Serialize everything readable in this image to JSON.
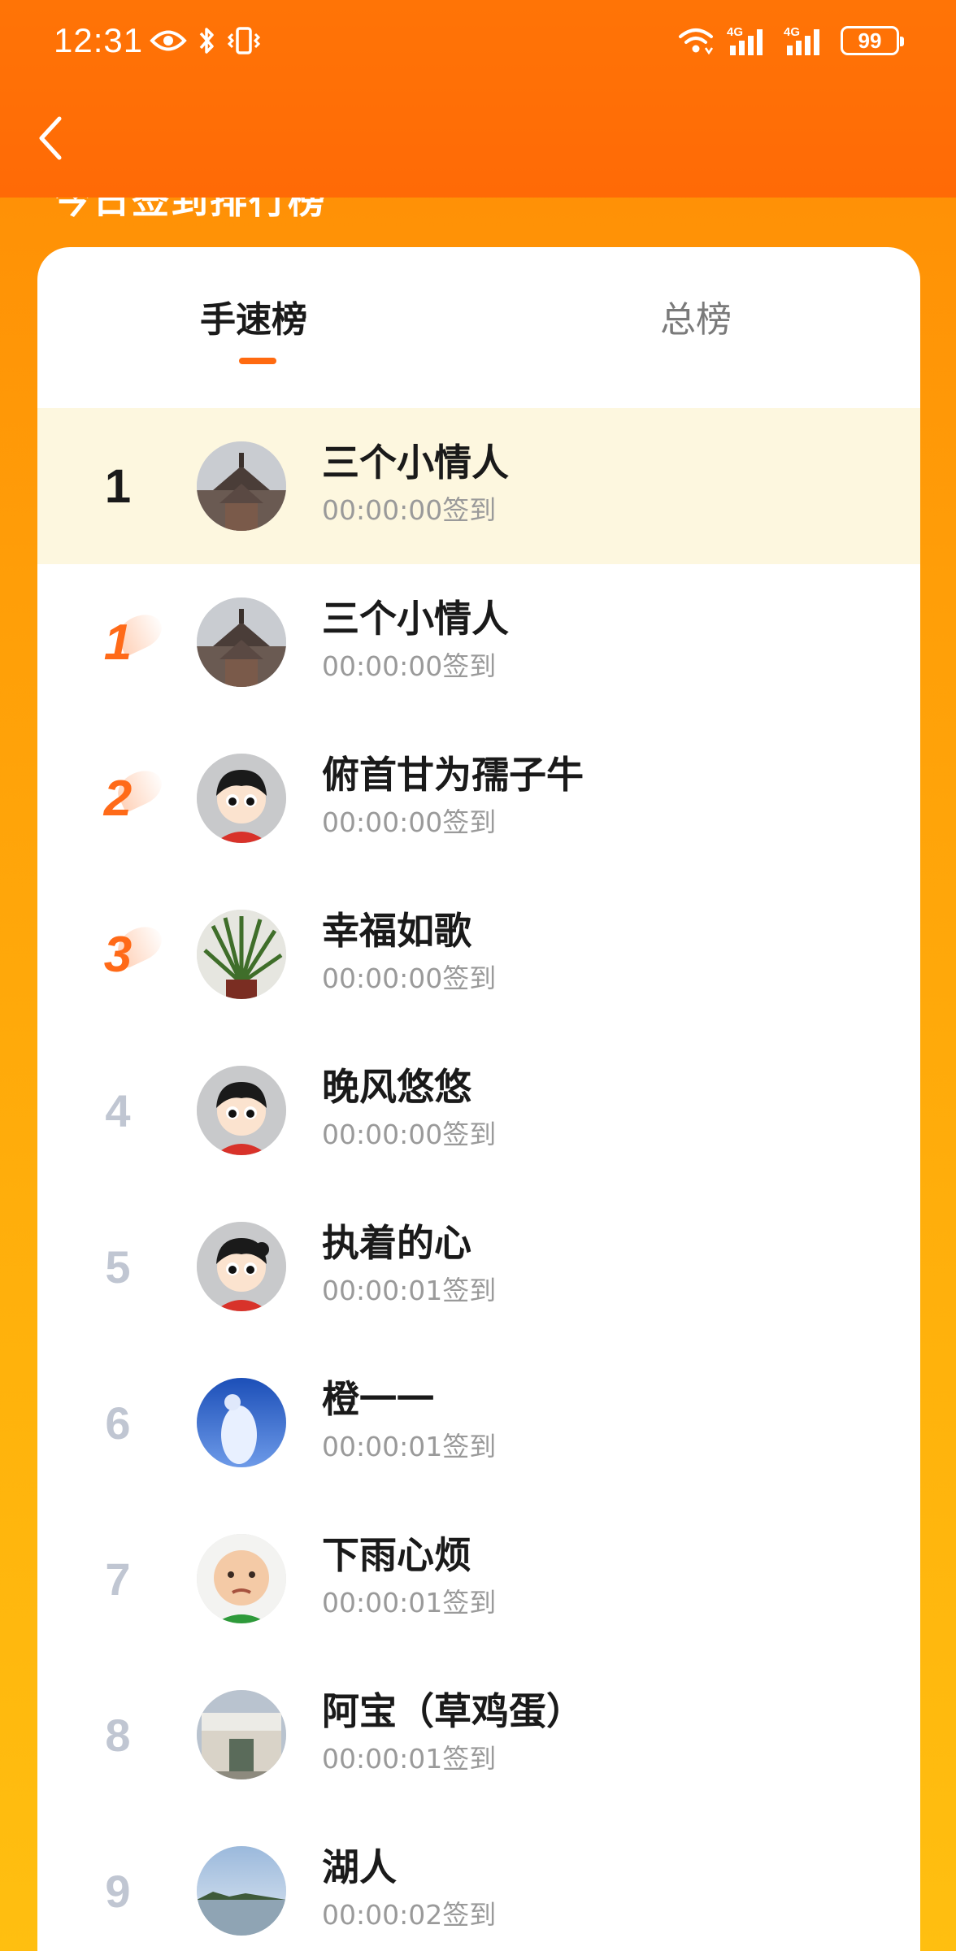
{
  "status_bar": {
    "time": "12:31",
    "battery": "99",
    "icons_left": [
      "eye-icon",
      "bluetooth-icon",
      "vibrate-icon"
    ],
    "icons_right": [
      "wifi-icon",
      "signal-4g-icon",
      "signal-4g-icon",
      "battery-icon"
    ]
  },
  "header": {
    "back_icon": "chevron-left-icon",
    "hidden_title": "今日签到排行榜"
  },
  "tabs": [
    {
      "label": "手速榜",
      "active": true
    },
    {
      "label": "总榜",
      "active": false
    }
  ],
  "colors": {
    "header_bg": "#ff6a06",
    "accent": "#ff6a10",
    "highlight_row": "#fdf7df",
    "gradient_bottom": "#ffbf10"
  },
  "my_rank": {
    "rank": "1",
    "name": "三个小情人",
    "time": "00:00:00签到",
    "avatar": "pagoda-avatar"
  },
  "ranking": [
    {
      "rank": "1",
      "name": "三个小情人",
      "time": "00:00:00签到",
      "avatar": "pagoda-avatar"
    },
    {
      "rank": "2",
      "name": "俯首甘为孺子牛",
      "time": "00:00:00签到",
      "avatar": "cartoon-face-avatar"
    },
    {
      "rank": "3",
      "name": "幸福如歌",
      "time": "00:00:00签到",
      "avatar": "plant-avatar"
    },
    {
      "rank": "4",
      "name": "晚风悠悠",
      "time": "00:00:00签到",
      "avatar": "cartoon-face-avatar"
    },
    {
      "rank": "5",
      "name": "执着的心",
      "time": "00:00:01签到",
      "avatar": "cartoon-face-avatar"
    },
    {
      "rank": "6",
      "name": "橙一一",
      "time": "00:00:01签到",
      "avatar": "blue-figure-avatar"
    },
    {
      "rank": "7",
      "name": "下雨心烦",
      "time": "00:00:01签到",
      "avatar": "baby-avatar"
    },
    {
      "rank": "8",
      "name": "阿宝（草鸡蛋）",
      "time": "00:00:01签到",
      "avatar": "park-gate-avatar"
    },
    {
      "rank": "9",
      "name": "湖人",
      "time": "00:00:02签到",
      "avatar": "lake-avatar"
    }
  ]
}
